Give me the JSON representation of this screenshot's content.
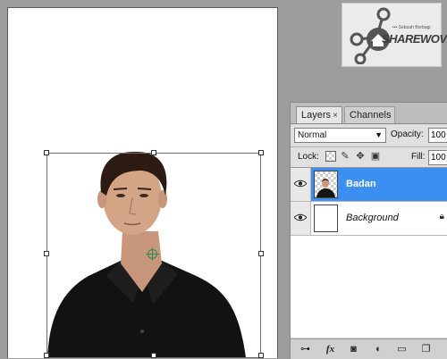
{
  "watermark": {
    "brand": "SHAREWOVEL",
    "tagline": "••• Sebuah Berbagi"
  },
  "canvas": {
    "subject": "person-photo"
  },
  "layers_panel": {
    "tabs": [
      {
        "label": "Layers",
        "close": "×"
      },
      {
        "label": "Channels"
      }
    ],
    "blend_mode": "Normal",
    "opacity_label": "Opacity:",
    "opacity_value": "100",
    "lock_label": "Lock:",
    "fill_label": "Fill:",
    "fill_value": "100",
    "layers": [
      {
        "name": "Badan",
        "selected": true,
        "visible": true
      },
      {
        "name": "Background",
        "selected": false,
        "visible": true,
        "locked": true
      }
    ]
  },
  "colors": {
    "selection": "#3b8ff0",
    "workspace": "#9d9d9d"
  }
}
